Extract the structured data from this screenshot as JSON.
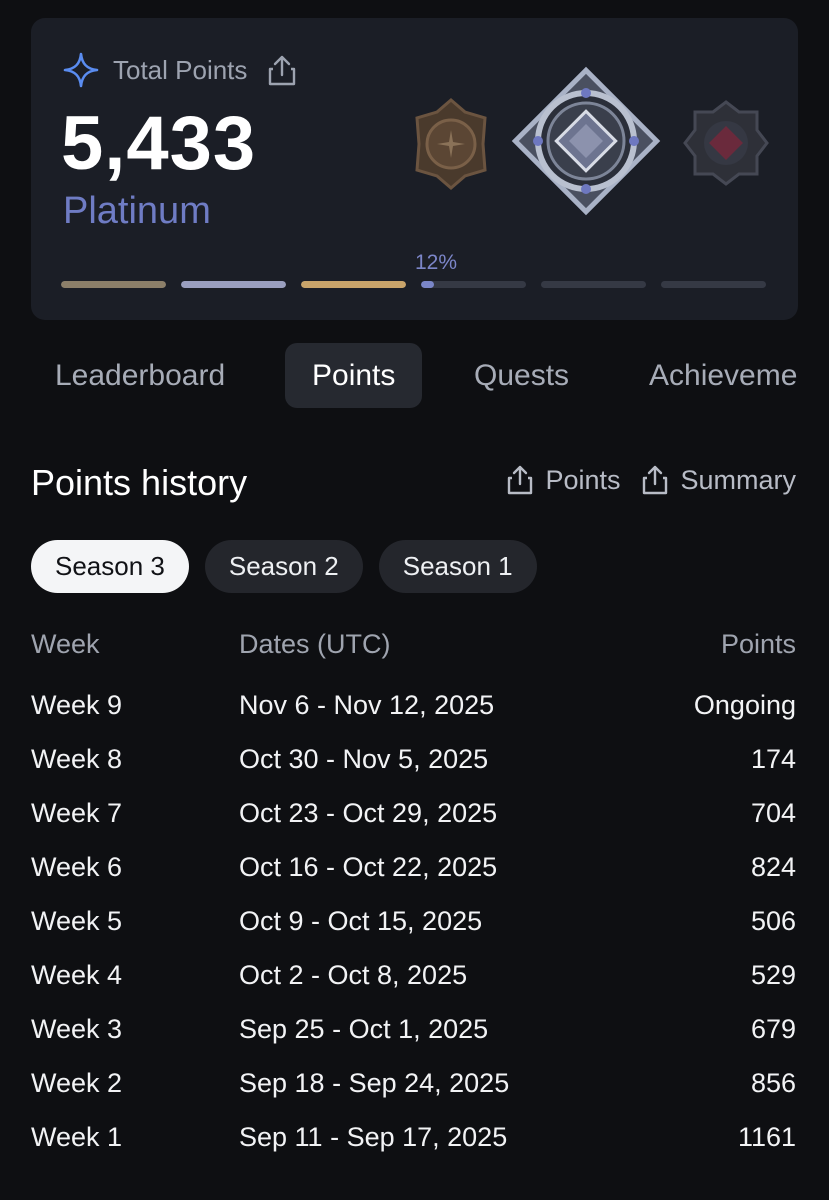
{
  "summary": {
    "label": "Total Points",
    "total": "5,433",
    "tier": "Platinum",
    "progress_label": "12%",
    "progress_fraction": 0.12,
    "tier_segments": [
      {
        "name": "bronze",
        "color": "#8c7f69",
        "filled": 1
      },
      {
        "name": "silver",
        "color": "#9a9fbf",
        "filled": 1
      },
      {
        "name": "gold",
        "color": "#c9a46a",
        "filled": 1
      },
      {
        "name": "platinum",
        "color": "#7a86c8",
        "filled": 0.12
      },
      {
        "name": "diamond",
        "color": "#353944",
        "filled": 0
      },
      {
        "name": "master",
        "color": "#353944",
        "filled": 0
      }
    ],
    "badges": [
      "previous-tier-badge",
      "platinum-badge",
      "next-tier-badge"
    ]
  },
  "tabs": [
    "Leaderboard",
    "Points",
    "Quests",
    "Achieveme"
  ],
  "active_tab": "Points",
  "history": {
    "title": "Points history",
    "exports": [
      "Points",
      "Summary"
    ],
    "seasons": [
      "Season 3",
      "Season 2",
      "Season 1"
    ],
    "active_season": "Season 3",
    "columns": [
      "Week",
      "Dates (UTC)",
      "Points"
    ],
    "rows": [
      {
        "week": "Week 9",
        "dates": "Nov 6 - Nov 12, 2025",
        "points": "Ongoing"
      },
      {
        "week": "Week 8",
        "dates": "Oct 30 - Nov 5, 2025",
        "points": "174"
      },
      {
        "week": "Week 7",
        "dates": "Oct 23 - Oct 29, 2025",
        "points": "704"
      },
      {
        "week": "Week 6",
        "dates": "Oct 16 - Oct 22, 2025",
        "points": "824"
      },
      {
        "week": "Week 5",
        "dates": "Oct 9 - Oct 15, 2025",
        "points": "506"
      },
      {
        "week": "Week 4",
        "dates": "Oct 2 - Oct 8, 2025",
        "points": "529"
      },
      {
        "week": "Week 3",
        "dates": "Sep 25 - Oct 1, 2025",
        "points": "679"
      },
      {
        "week": "Week 2",
        "dates": "Sep 18 - Sep 24, 2025",
        "points": "856"
      },
      {
        "week": "Week 1",
        "dates": "Sep 11 - Sep 17, 2025",
        "points": "1161"
      }
    ]
  },
  "colors": {
    "background": "#0e0f12",
    "card": "#1b1e26",
    "accent": "#6f7cc4"
  }
}
